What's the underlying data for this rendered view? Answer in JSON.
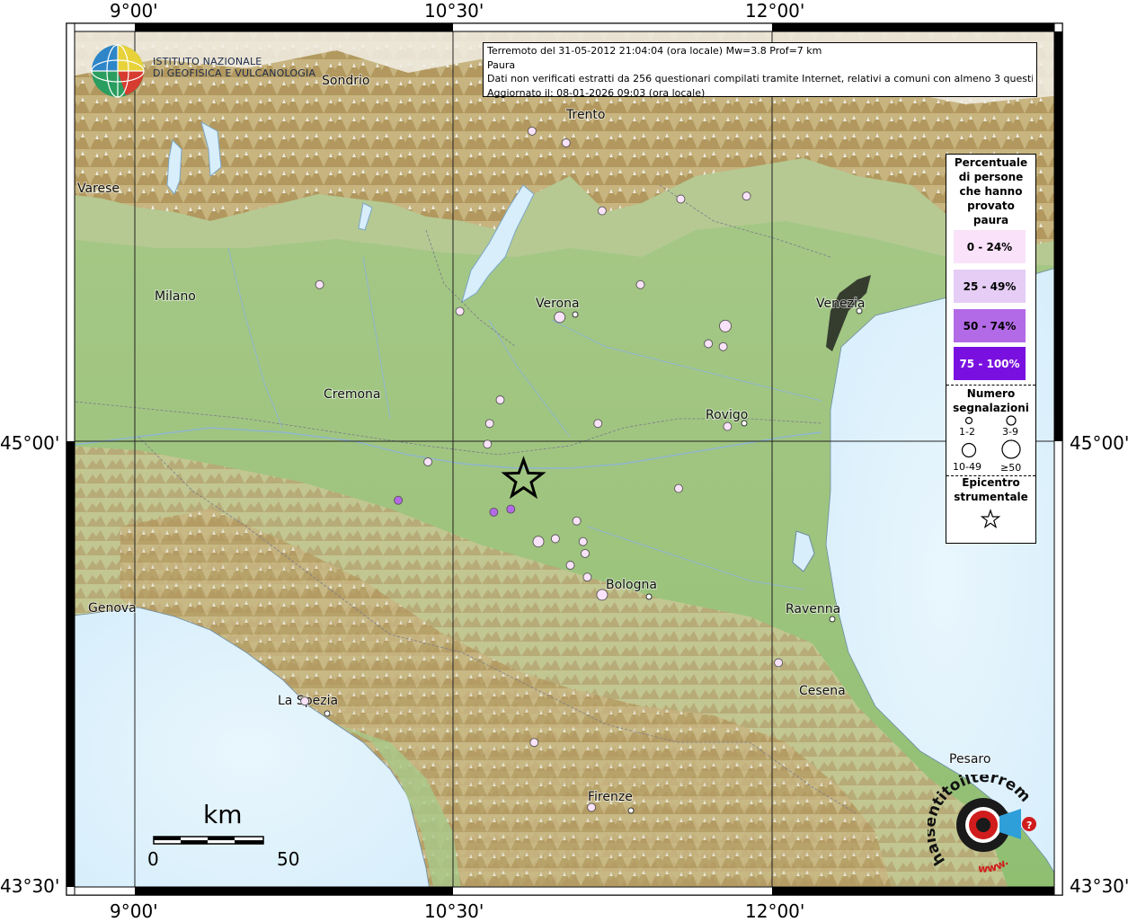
{
  "map": {
    "axis_labels": {
      "top": [
        "9°00'",
        "10°30'",
        "12°00'"
      ],
      "bottom": [
        "9°00'",
        "10°30'",
        "12°00'"
      ],
      "left": [
        "45°00'",
        "43°30'"
      ],
      "right": [
        "45°00'",
        "43°30'"
      ]
    },
    "info": {
      "line1": "Terremoto del 31-05-2012 21:04:04 (ora locale) Mw=3.8 Prof=7 km",
      "line2": "Paura",
      "line3": "Dati non verificati estratti da 256 questionari compilati tramite Internet, relativi a comuni con almeno 3 questionari.",
      "line4": "Aggiornato il: 08-01-2026 09:03 (ora locale)"
    },
    "logo_ingv": {
      "line1": "ISTITUTO NAZIONALE",
      "line2": "DI GEOFISICA E VULCANOLOGIA"
    },
    "logo_hsit": {
      "text": "haisentitoilterremoto.it",
      "prefix": "www."
    },
    "cities": [
      "Sondrio",
      "Trento",
      "Varese",
      "Milano",
      "Verona",
      "Venezia",
      "Cremona",
      "Rovigo",
      "Genova",
      "Bologna",
      "Ravenna",
      "La Spezia",
      "Cesena",
      "Pesaro",
      "Firenze"
    ],
    "legend": {
      "title": [
        "Percentuale",
        "di persone",
        "che hanno",
        "provato",
        "paura"
      ],
      "classes": [
        {
          "label": "0 - 24%",
          "color": "#fae3fa"
        },
        {
          "label": "25 - 49%",
          "color": "#e5cdf5"
        },
        {
          "label": "50 - 74%",
          "color": "#b36ae6"
        },
        {
          "label": "75 - 100%",
          "color": "#7a10e0"
        }
      ],
      "count_title": [
        "Numero",
        "segnalazioni"
      ],
      "count_classes": [
        "1-2",
        "3-9",
        "10-49",
        "≥50"
      ],
      "epicenter_title": [
        "Epicentro",
        "strumentale"
      ]
    },
    "scale_bar": {
      "unit": "km",
      "min": "0",
      "max": "50"
    },
    "epicenter": {
      "lon": 10.83,
      "lat": 44.87
    },
    "points": [
      {
        "lon": 10.87,
        "lat": 46.05,
        "cls": 1,
        "size": 1
      },
      {
        "lon": 11.03,
        "lat": 46.01,
        "cls": 1,
        "size": 1
      },
      {
        "lon": 11.2,
        "lat": 45.78,
        "cls": 1,
        "size": 1
      },
      {
        "lon": 11.57,
        "lat": 45.82,
        "cls": 1,
        "size": 1
      },
      {
        "lon": 11.88,
        "lat": 45.83,
        "cls": 1,
        "size": 1
      },
      {
        "lon": 9.87,
        "lat": 45.53,
        "cls": 1,
        "size": 1
      },
      {
        "lon": 10.53,
        "lat": 45.44,
        "cls": 1,
        "size": 1
      },
      {
        "lon": 11.38,
        "lat": 45.53,
        "cls": 1,
        "size": 1
      },
      {
        "lon": 11.0,
        "lat": 45.42,
        "cls": 1,
        "size": 2
      },
      {
        "lon": 11.78,
        "lat": 45.39,
        "cls": 1,
        "size": 3
      },
      {
        "lon": 11.7,
        "lat": 45.33,
        "cls": 1,
        "size": 1
      },
      {
        "lon": 11.77,
        "lat": 45.32,
        "cls": 1,
        "size": 1
      },
      {
        "lon": 10.72,
        "lat": 45.14,
        "cls": 1,
        "size": 1
      },
      {
        "lon": 10.67,
        "lat": 45.06,
        "cls": 1,
        "size": 1
      },
      {
        "lon": 11.18,
        "lat": 45.06,
        "cls": 1,
        "size": 1
      },
      {
        "lon": 11.79,
        "lat": 45.05,
        "cls": 1,
        "size": 1
      },
      {
        "lon": 10.66,
        "lat": 44.99,
        "cls": 1,
        "size": 1
      },
      {
        "lon": 10.38,
        "lat": 44.93,
        "cls": 1,
        "size": 1
      },
      {
        "lon": 11.56,
        "lat": 44.84,
        "cls": 1,
        "size": 1
      },
      {
        "lon": 10.24,
        "lat": 44.8,
        "cls": 3,
        "size": 1
      },
      {
        "lon": 10.69,
        "lat": 44.76,
        "cls": 3,
        "size": 1
      },
      {
        "lon": 10.77,
        "lat": 44.77,
        "cls": 3,
        "size": 1
      },
      {
        "lon": 11.08,
        "lat": 44.73,
        "cls": 1,
        "size": 1
      },
      {
        "lon": 10.9,
        "lat": 44.66,
        "cls": 1,
        "size": 2
      },
      {
        "lon": 10.98,
        "lat": 44.67,
        "cls": 1,
        "size": 1
      },
      {
        "lon": 11.11,
        "lat": 44.66,
        "cls": 1,
        "size": 1
      },
      {
        "lon": 11.05,
        "lat": 44.58,
        "cls": 1,
        "size": 1
      },
      {
        "lon": 11.12,
        "lat": 44.62,
        "cls": 1,
        "size": 1
      },
      {
        "lon": 11.13,
        "lat": 44.54,
        "cls": 1,
        "size": 1
      },
      {
        "lon": 11.2,
        "lat": 44.48,
        "cls": 1,
        "size": 2
      },
      {
        "lon": 12.03,
        "lat": 44.25,
        "cls": 1,
        "size": 1
      },
      {
        "lon": 9.8,
        "lat": 44.12,
        "cls": 1,
        "size": 1
      },
      {
        "lon": 10.88,
        "lat": 43.98,
        "cls": 1,
        "size": 1
      },
      {
        "lon": 11.15,
        "lat": 43.76,
        "cls": 1,
        "size": 1
      }
    ]
  }
}
